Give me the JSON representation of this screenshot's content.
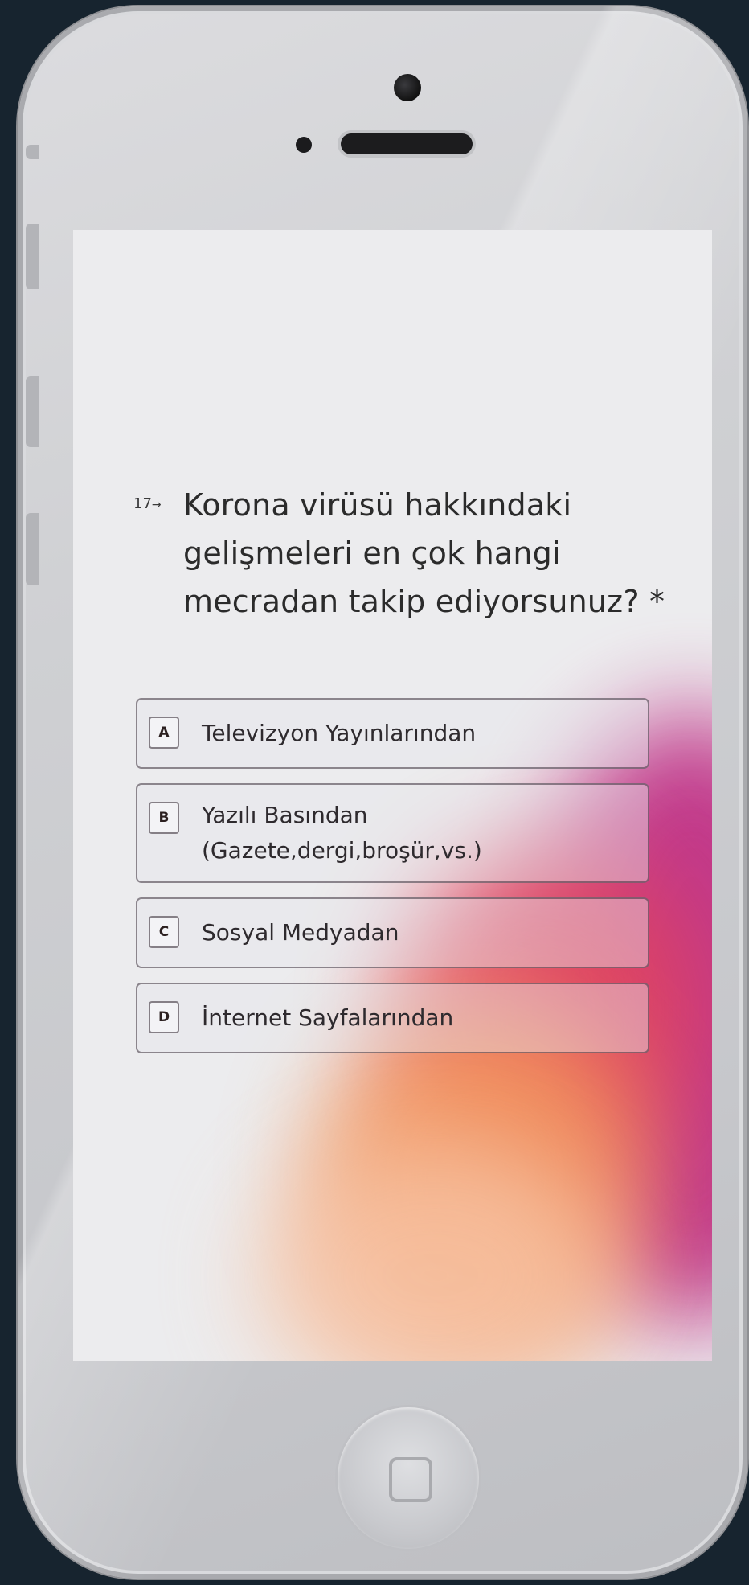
{
  "question": {
    "number": "17",
    "arrow": "→",
    "text": "Korona virüsü hakkındaki gelişmeleri en çok hangi mecradan takip ediyorsunuz? *"
  },
  "options": [
    {
      "key": "A",
      "label": "Televizyon Yayınlarından"
    },
    {
      "key": "B",
      "label_line1": "Yazılı Basından",
      "label_line2": "(Gazete,dergi,broşür,vs.)"
    },
    {
      "key": "C",
      "label": "Sosyal Medyadan"
    },
    {
      "key": "D",
      "label": "İnternet Sayfalarından"
    }
  ],
  "colors": {
    "background": "#17242f",
    "screen": "#ececee",
    "accent_pink": "#bf2f85",
    "accent_orange": "#f2935a"
  }
}
